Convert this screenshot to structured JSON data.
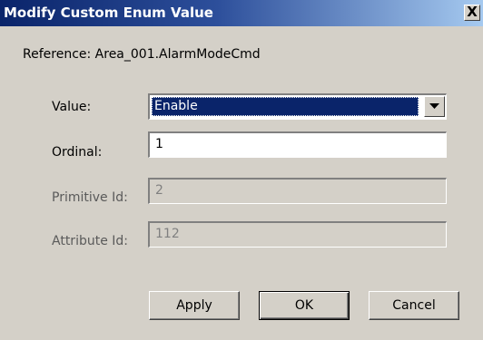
{
  "window": {
    "title": "Modify Custom Enum Value",
    "close_symbol": "X"
  },
  "reference": {
    "text": "Reference:  Area_001.AlarmModeCmd"
  },
  "fields": {
    "value": {
      "label": "Value:",
      "selected": "Enable"
    },
    "ordinal": {
      "label": "Ordinal:",
      "value": "1"
    },
    "primitive_id": {
      "label": "Primitive Id:",
      "value": "2"
    },
    "attribute_id": {
      "label": "Attribute Id:",
      "value": "112"
    }
  },
  "buttons": {
    "apply": "Apply",
    "ok": "OK",
    "cancel": "Cancel"
  }
}
